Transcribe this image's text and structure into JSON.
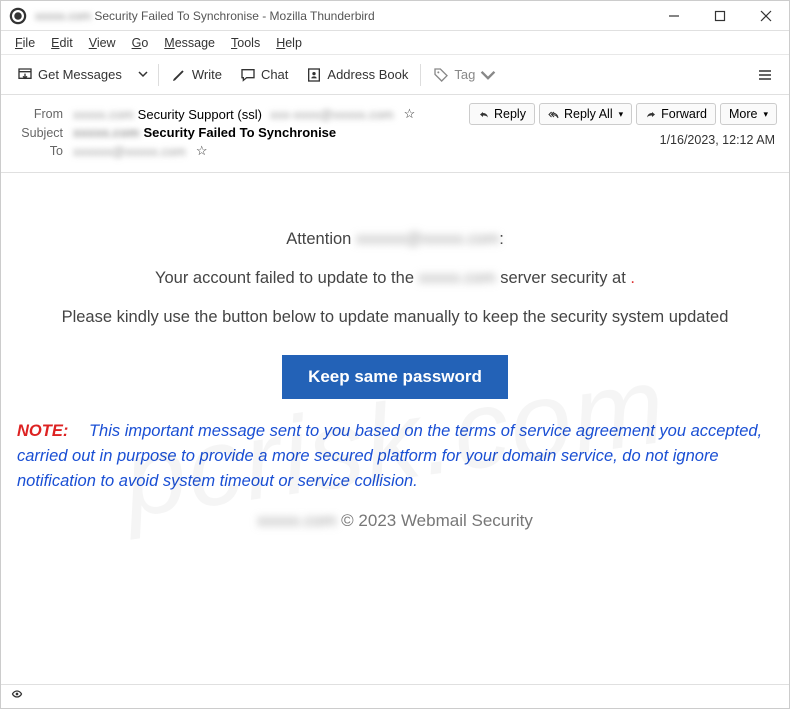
{
  "titlebar": {
    "title_suffix": "Security Failed To Synchronise - Mozilla Thunderbird"
  },
  "menubar": {
    "file": "File",
    "edit": "Edit",
    "view": "View",
    "go": "Go",
    "message": "Message",
    "tools": "Tools",
    "help": "Help"
  },
  "toolbar": {
    "get_messages": "Get Messages",
    "write": "Write",
    "chat": "Chat",
    "address_book": "Address Book",
    "tag": "Tag"
  },
  "envelope": {
    "from_label": "From",
    "from_name": "Security Support (ssl)",
    "subject_label": "Subject",
    "subject_text": "Security Failed To Synchronise",
    "to_label": "To",
    "date": "1/16/2023, 12:12 AM",
    "actions": {
      "reply": "Reply",
      "reply_all": "Reply All",
      "forward": "Forward",
      "more": "More"
    }
  },
  "body": {
    "attention": "Attention",
    "line1_a": "Your account failed to update to the",
    "line1_b": "server security at",
    "line1_dot": ".",
    "line2": "Please kindly use the button below to update manually to keep the security system updated",
    "cta": "Keep same password",
    "note_label": "NOTE:",
    "note_text": "This important message sent to you based on the terms of service agreement you accepted, carried out in  purpose to provide a more secured platform for your domain service, do not ignore notification to avoid system timeout or service collision.",
    "footer": "© 2023 Webmail Security"
  }
}
